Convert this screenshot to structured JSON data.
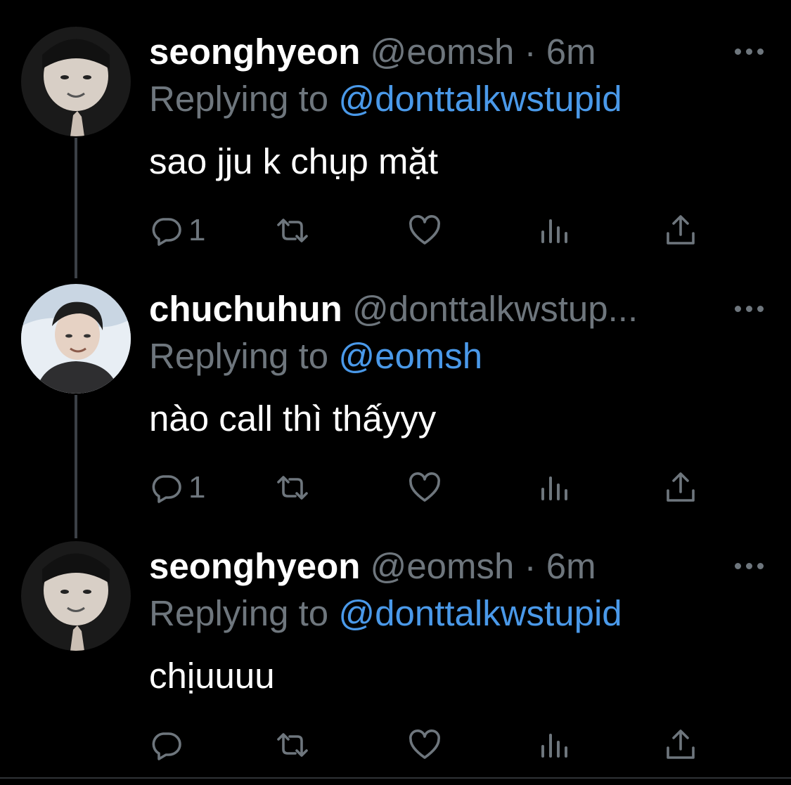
{
  "colors": {
    "background": "#000000",
    "text": "#ffffff",
    "muted": "#6e767d",
    "link": "#4a99e9",
    "thread_line": "#3b4046"
  },
  "tweets": [
    {
      "name": "seonghyeon",
      "handle": "@eomsh",
      "dot": "·",
      "time": "6m",
      "reply_prefix": "Replying to ",
      "reply_handle": "@donttalkwstupid",
      "text": "sao jju k chụp mặt",
      "reply_count": "1",
      "avatar": "avatar-seonghyeon"
    },
    {
      "name": "chuchuhun",
      "handle": "@donttalkwstup...",
      "dot": "",
      "time": "",
      "reply_prefix": "Replying to ",
      "reply_handle": "@eomsh",
      "text": "nào call thì thấyyy",
      "reply_count": "1",
      "avatar": "avatar-chuchuhun"
    },
    {
      "name": "seonghyeon",
      "handle": "@eomsh",
      "dot": "·",
      "time": "6m",
      "reply_prefix": "Replying to ",
      "reply_handle": "@donttalkwstupid",
      "text": "chịuuuu",
      "reply_count": "",
      "avatar": "avatar-seonghyeon"
    }
  ],
  "icons": [
    "reply-icon",
    "retweet-icon",
    "like-icon",
    "analytics-icon",
    "share-icon",
    "more-icon"
  ]
}
